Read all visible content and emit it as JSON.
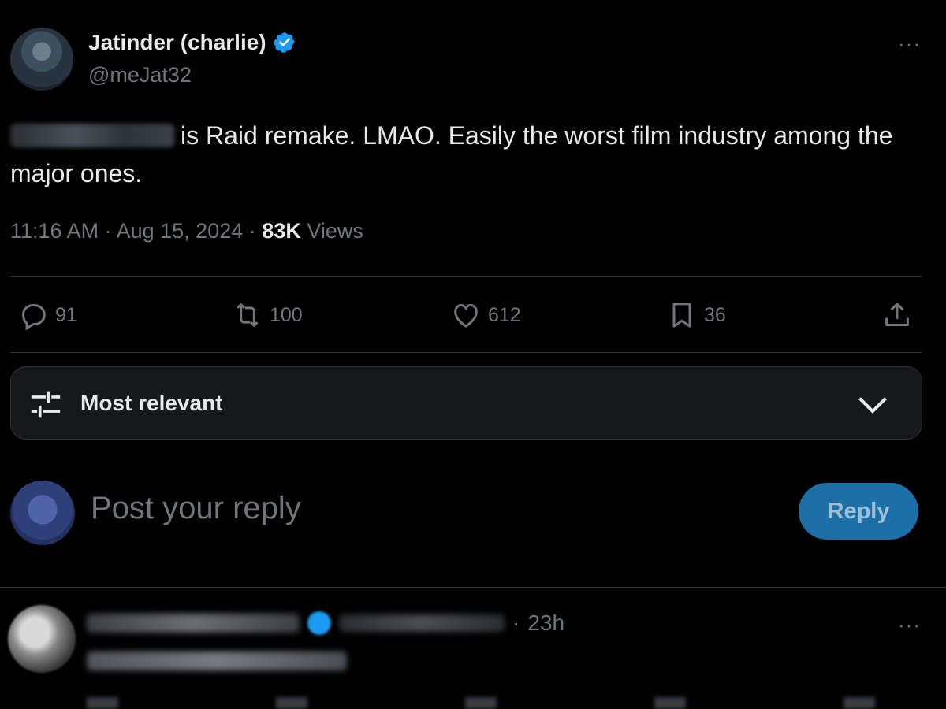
{
  "tweet": {
    "author_name": "Jatinder (charlie)",
    "author_handle": "@meJat32",
    "more_label": "···",
    "text": "is Raid remake. LMAO. Easily the worst film industry among the major ones.",
    "time": "11:16 AM",
    "separator": "·",
    "date": "Aug 15, 2024",
    "views_count": "83K",
    "views_label": "Views"
  },
  "actions": {
    "replies": "91",
    "reposts": "100",
    "likes": "612",
    "bookmarks": "36"
  },
  "sort": {
    "label": "Most relevant"
  },
  "composer": {
    "placeholder": "Post your reply",
    "button_label": "Reply"
  },
  "next_reply": {
    "time": "23h",
    "separator": "·",
    "more_label": "···"
  },
  "colors": {
    "background": "#000000",
    "text_primary": "#e7e9ea",
    "text_secondary": "#71767b",
    "verified_blue": "#1d9bf0",
    "reply_button": "#1d6fa8"
  },
  "icons": [
    "verified-badge-icon",
    "more-icon",
    "reply-icon",
    "repost-icon",
    "like-icon",
    "bookmark-icon",
    "share-icon",
    "sort-sliders-icon",
    "chevron-down-icon"
  ]
}
